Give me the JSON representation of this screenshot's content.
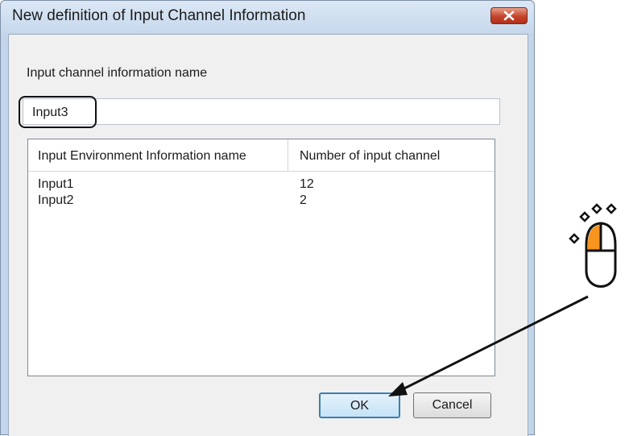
{
  "dialog": {
    "title": "New definition of Input Channel Information",
    "close_icon": "close-icon",
    "name_label": "Input channel information name",
    "name_value": "Input3",
    "table": {
      "columns": [
        "Input Environment Information name",
        "Number of input channel"
      ],
      "rows": [
        {
          "name": "Input1",
          "channels": "12"
        },
        {
          "name": "Input2",
          "channels": "2"
        }
      ]
    },
    "ok_label": "OK",
    "cancel_label": "Cancel"
  },
  "annotation": {
    "mouse_icon": "mouse-left-click-icon",
    "accent_color": "#f7941d"
  }
}
